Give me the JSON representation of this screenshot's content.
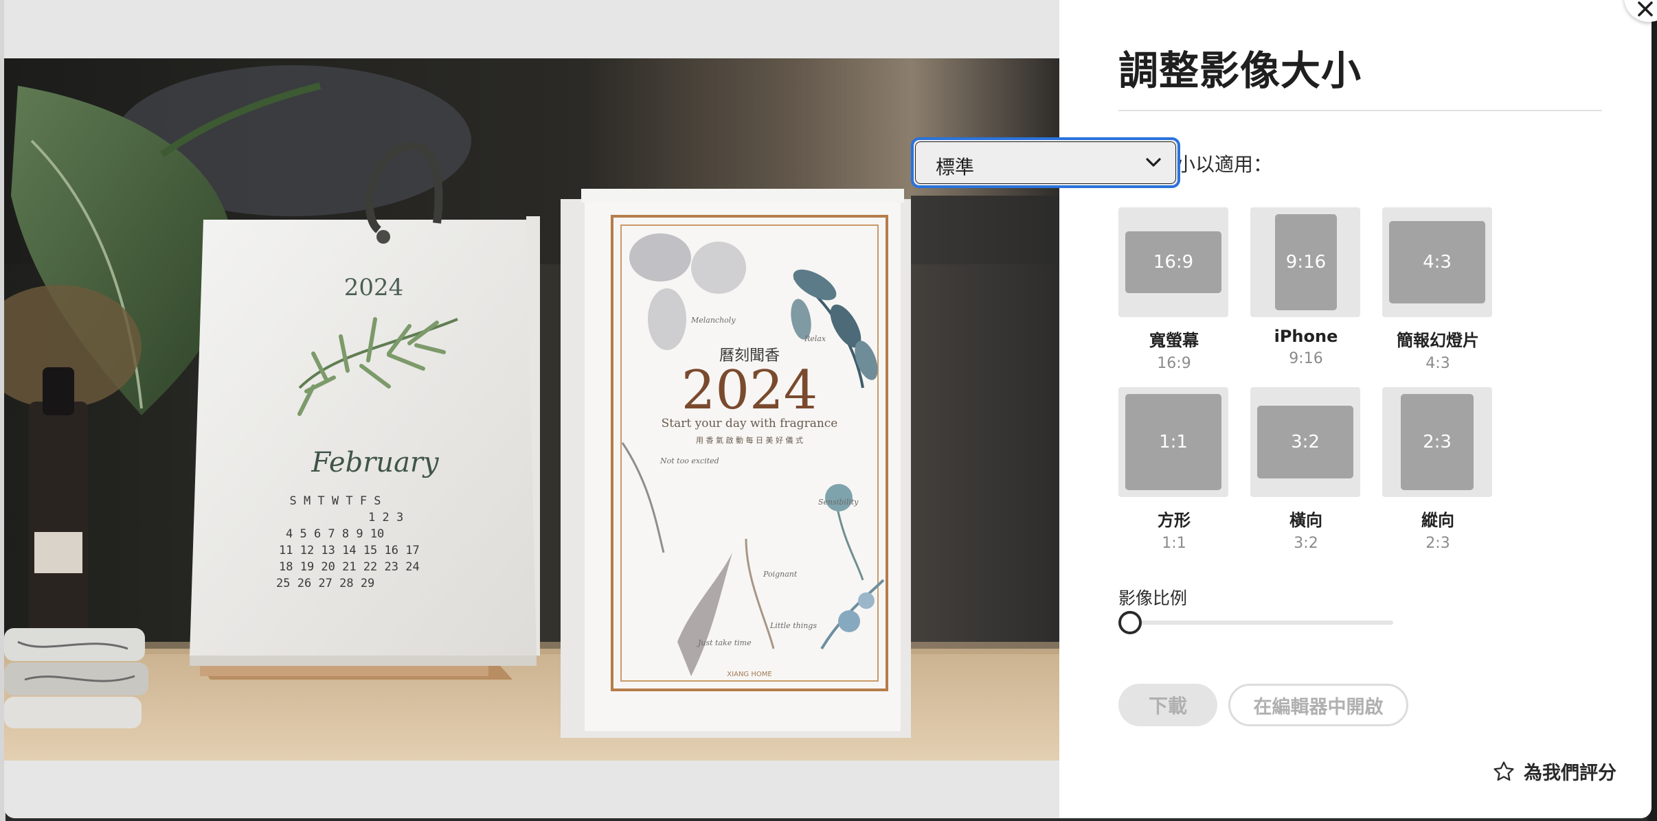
{
  "dialog": {
    "title": "調整影像大小",
    "fit_label": "調整大小以適用：",
    "fit_select_value": "標準",
    "presets": [
      {
        "ratio_label": "16:9",
        "name": "寬螢幕",
        "sub": "16:9"
      },
      {
        "ratio_label": "9:16",
        "name": "iPhone",
        "sub": "9:16"
      },
      {
        "ratio_label": "4:3",
        "name": "簡報幻燈片",
        "sub": "4:3"
      },
      {
        "ratio_label": "1:1",
        "name": "方形",
        "sub": "1:1"
      },
      {
        "ratio_label": "3:2",
        "name": "橫向",
        "sub": "3:2"
      },
      {
        "ratio_label": "2:3",
        "name": "縱向",
        "sub": "2:3"
      }
    ],
    "scale_label": "影像比例",
    "scale_value": 0,
    "download_label": "下載",
    "open_editor_label": "在編輯器中開啟",
    "rate_label": "為我們評分",
    "accent_color": "#2a73dc"
  },
  "preview": {
    "desk_calendar": {
      "year": "2024",
      "month": "February",
      "weekdays": "S M T W T F S",
      "week1": "1 2 3",
      "week2": "4 5 6 7 8 9 10",
      "week3": "11 12 13 14 15 16 17",
      "week4": "18 19 20 21 22 23 24",
      "week5": "25 26 27 28 29"
    },
    "box": {
      "heading": "曆刻聞香",
      "year": "2024",
      "tagline": "Start your day with fragrance",
      "subtitle": "用 香 氣 啟 動 每 日 美 好 儀 式",
      "brand": "XIANG HOME",
      "notes": [
        "Melancholy",
        "Relax",
        "Not too excited",
        "Sensibility",
        "Poignant",
        "Just take time",
        "Little things"
      ]
    }
  }
}
